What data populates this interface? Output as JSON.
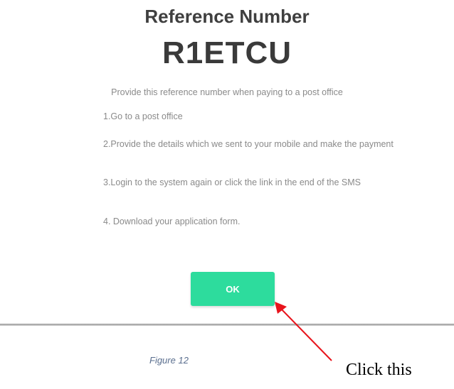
{
  "dialog": {
    "title": "Reference Number",
    "reference_code": "R1ETCU",
    "instruction": "Provide this reference number when paying to a post office",
    "steps": [
      "1.Go to a post office",
      "2.Provide the details which we sent to your mobile and make the payment",
      "3.Login to the system again or click the link in the end of the SMS",
      "4. Download your application form."
    ],
    "ok_label": "OK"
  },
  "document": {
    "figure_caption": "Figure 12",
    "callout": "Click this"
  },
  "colors": {
    "ok_button": "#2ddc9d",
    "arrow": "#e8141c",
    "caption": "#5b6f8f"
  }
}
